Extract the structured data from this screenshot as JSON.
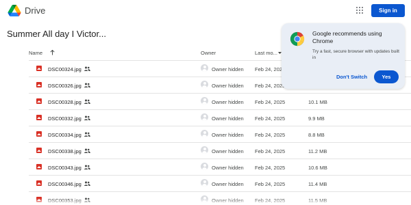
{
  "app": {
    "name": "Drive"
  },
  "header": {
    "sign_in_label": "Sign in"
  },
  "folder": {
    "title": "Summer All day I Victor..."
  },
  "table": {
    "columns": {
      "name": "Name",
      "owner": "Owner",
      "modified": "Last mo..."
    },
    "rows": [
      {
        "name": "DSC00324.jpg",
        "owner": "Owner hidden",
        "modified": "Feb 24, 2025",
        "size": ""
      },
      {
        "name": "DSC00326.jpg",
        "owner": "Owner hidden",
        "modified": "Feb 24, 2025",
        "size": ""
      },
      {
        "name": "DSC00328.jpg",
        "owner": "Owner hidden",
        "modified": "Feb 24, 2025",
        "size": "10.1 MB"
      },
      {
        "name": "DSC00332.jpg",
        "owner": "Owner hidden",
        "modified": "Feb 24, 2025",
        "size": "9.9 MB"
      },
      {
        "name": "DSC00334.jpg",
        "owner": "Owner hidden",
        "modified": "Feb 24, 2025",
        "size": "8.8 MB"
      },
      {
        "name": "DSC00338.jpg",
        "owner": "Owner hidden",
        "modified": "Feb 24, 2025",
        "size": "11.2 MB"
      },
      {
        "name": "DSC00343.jpg",
        "owner": "Owner hidden",
        "modified": "Feb 24, 2025",
        "size": "10.6 MB"
      },
      {
        "name": "DSC00346.jpg",
        "owner": "Owner hidden",
        "modified": "Feb 24, 2025",
        "size": "11.4 MB"
      },
      {
        "name": "DSC00353.jpg",
        "owner": "Owner hidden",
        "modified": "Feb 24, 2025",
        "size": "11.5 MB"
      }
    ]
  },
  "promo": {
    "title": "Google recommends using Chrome",
    "description": "Try a fast, secure browser with updates built in",
    "dont_switch_label": "Don't Switch",
    "yes_label": "Yes"
  },
  "icons": {
    "logo": "google-drive-logo-icon",
    "apps": "apps-grid-icon",
    "sort": "arrow-up-icon",
    "file": "image-file-icon",
    "shared": "shared-people-icon",
    "avatar": "person-avatar-icon",
    "chrome": "chrome-logo-icon"
  },
  "colors": {
    "accent": "#0b57d0",
    "promo_bg": "#e9eef6",
    "image_icon": "#d93025"
  }
}
